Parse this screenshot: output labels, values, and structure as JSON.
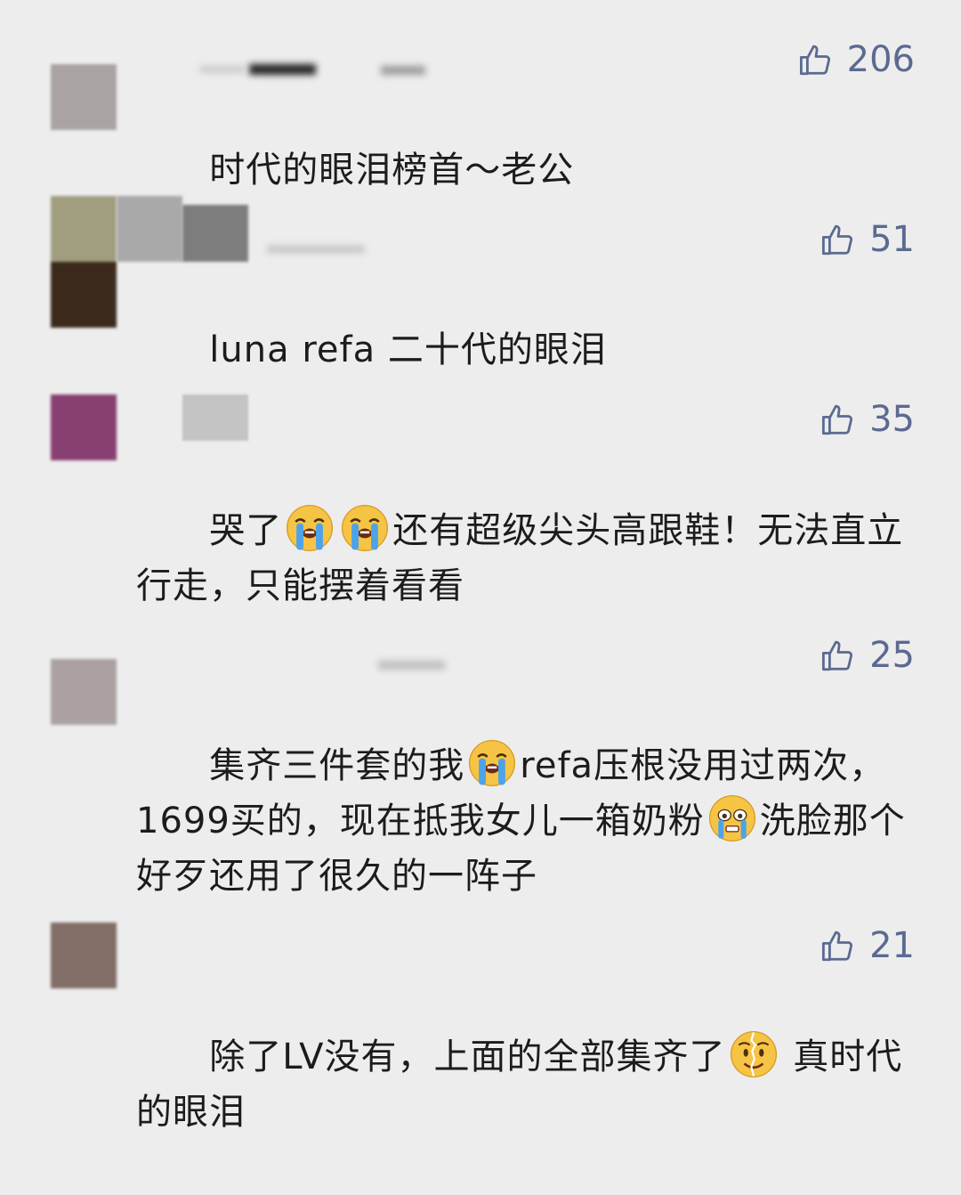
{
  "comments": [
    {
      "likes": "206",
      "avatar_colors": [
        "#aaa3a3"
      ],
      "segments": [
        {
          "t": "text",
          "v": "时代的眼泪榜首～老公"
        }
      ]
    },
    {
      "likes": "51",
      "avatar_colors": [
        "#a19e80",
        "#3b2a1c"
      ],
      "segments": [
        {
          "t": "text",
          "v": "luna refa 二十代的眼泪"
        }
      ]
    },
    {
      "likes": "35",
      "avatar_colors": [
        "#883f72"
      ],
      "segments": [
        {
          "t": "text",
          "v": "哭了"
        },
        {
          "t": "emoji",
          "v": "loudly-crying-emoji"
        },
        {
          "t": "emoji",
          "v": "loudly-crying-emoji"
        },
        {
          "t": "text",
          "v": "还有超级尖头高跟鞋！无法直立行走，只能摆着看看"
        }
      ]
    },
    {
      "likes": "25",
      "avatar_colors": [
        "#aba1a1"
      ],
      "segments": [
        {
          "t": "text",
          "v": "集齐三件套的我"
        },
        {
          "t": "emoji",
          "v": "loudly-crying-emoji"
        },
        {
          "t": "text",
          "v": "refa压根没用过两次，1699买的，现在抵我女儿一箱奶粉"
        },
        {
          "t": "emoji",
          "v": "crying-face-emoji"
        },
        {
          "t": "text",
          "v": "洗脸那个好歹还用了很久的一阵子"
        }
      ]
    },
    {
      "likes": "21",
      "avatar_colors": [
        "#826d67"
      ],
      "segments": [
        {
          "t": "text",
          "v": "除了LV没有，上面的全部集齐了"
        },
        {
          "t": "emoji",
          "v": "broken-smile-emoji"
        },
        {
          "t": "text",
          "v": " 真时代的眼泪"
        }
      ]
    }
  ]
}
